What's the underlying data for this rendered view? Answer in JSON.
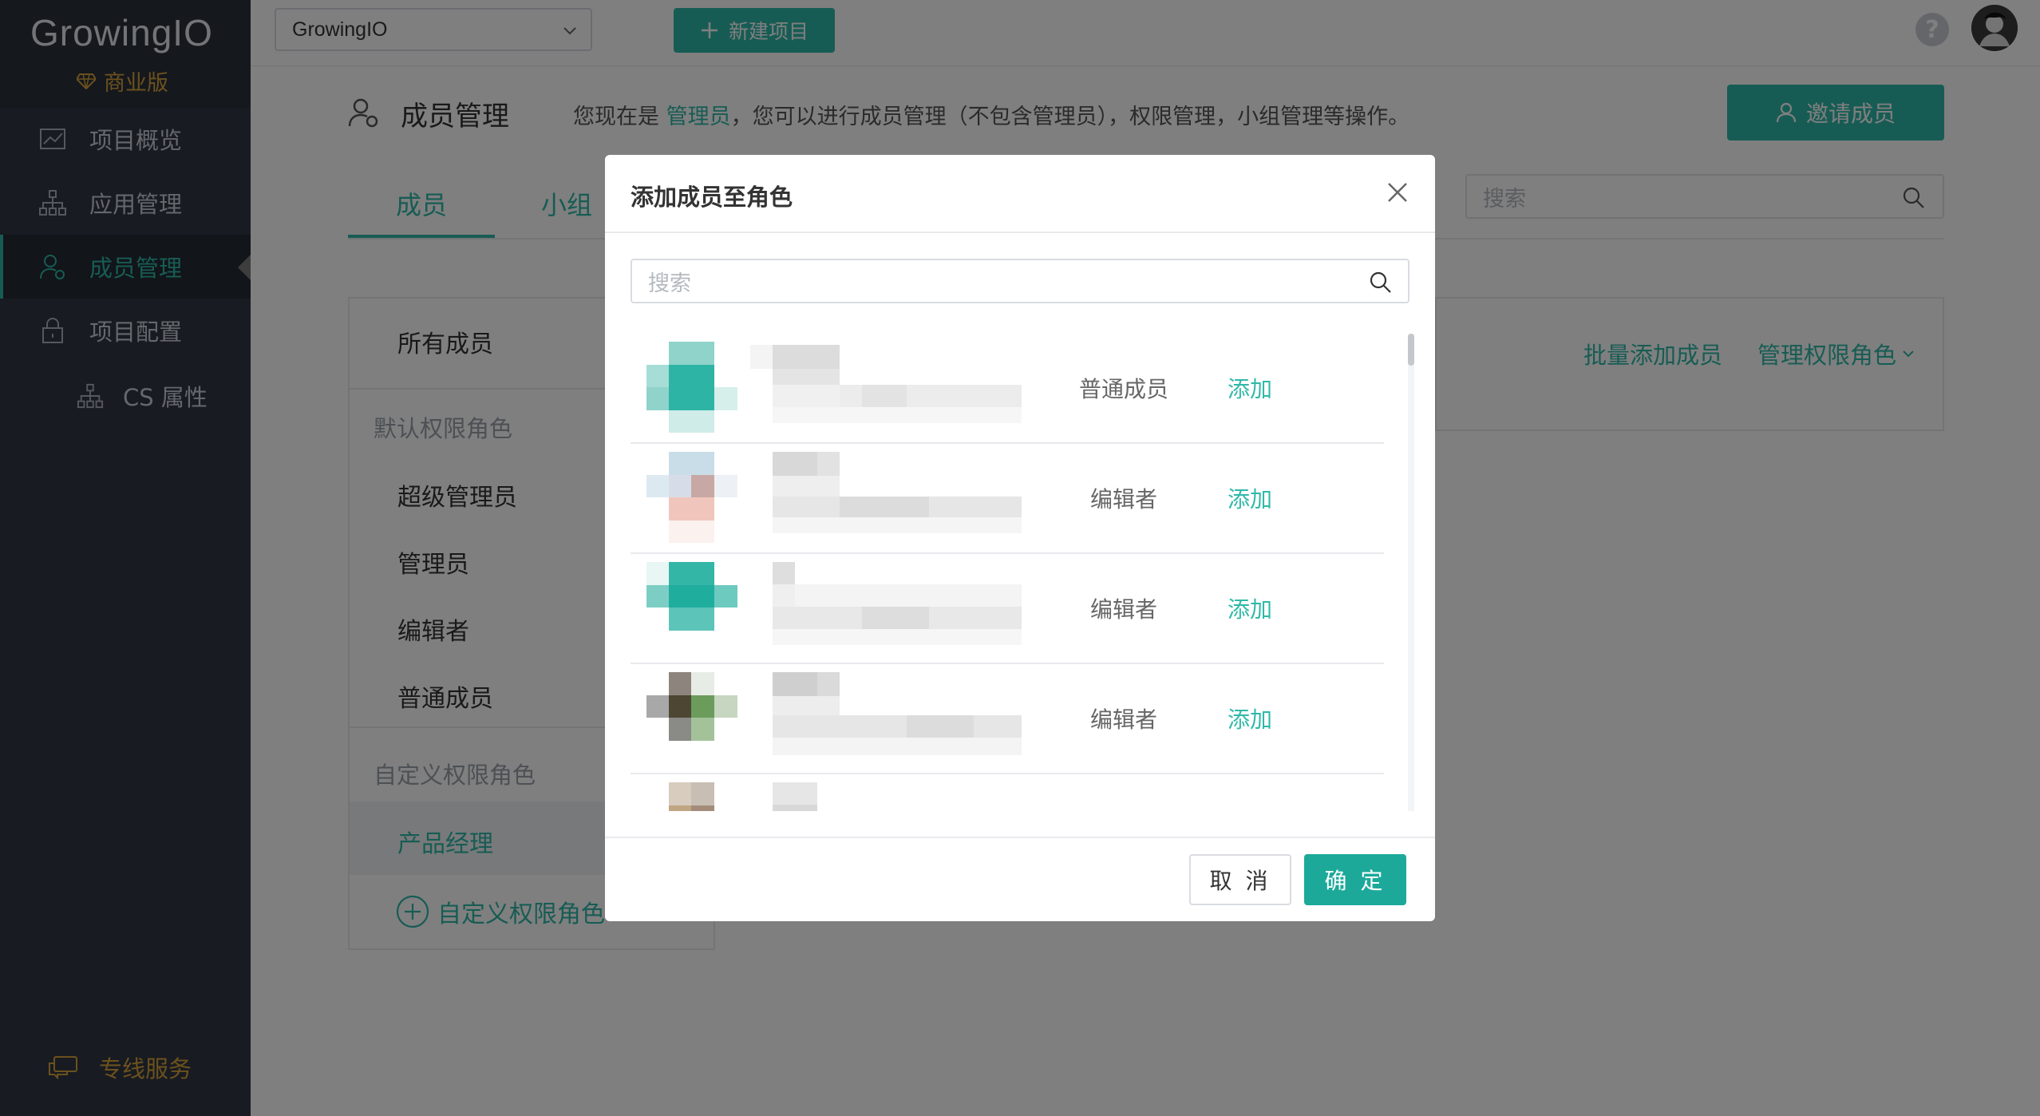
{
  "app": {
    "logo": "GrowingIO",
    "edition": "商业版",
    "service": "专线服务",
    "accent": "#2fb9a8"
  },
  "sidebar": {
    "items": [
      {
        "label": "项目概览",
        "icon": "line-chart-icon"
      },
      {
        "label": "应用管理",
        "icon": "sitemap-icon"
      },
      {
        "label": "成员管理",
        "icon": "user-gear-icon",
        "active": true
      },
      {
        "label": "项目配置",
        "icon": "lock-icon"
      },
      {
        "label": "CS 属性",
        "icon": "sitemap-icon"
      }
    ]
  },
  "header": {
    "project": "GrowingIO",
    "new_project": "新建项目",
    "help": "?"
  },
  "page": {
    "title": "成员管理",
    "desc_prefix": "您现在是",
    "desc_role": "管理员",
    "desc_suffix": "，您可以进行成员管理（不包含管理员），权限管理，小组管理等操作。",
    "invite": "邀请成员",
    "tabs": [
      "成员",
      "小组"
    ],
    "search_placeholder": "搜索",
    "left_panel": {
      "all_members": "所有成员",
      "default_roles_title": "默认权限角色",
      "default_roles": [
        "超级管理员",
        "管理员",
        "编辑者",
        "普通成员"
      ],
      "custom_roles_title": "自定义权限角色",
      "custom_roles": [
        "产品经理"
      ],
      "add_custom": "自定义权限角色"
    },
    "right_links": [
      "批量添加成员",
      "管理权限角色"
    ]
  },
  "modal": {
    "title": "添加成员至角色",
    "search_placeholder": "搜索",
    "rows": [
      {
        "role": "普通成员",
        "action": "添加"
      },
      {
        "role": "编辑者",
        "action": "添加"
      },
      {
        "role": "编辑者",
        "action": "添加"
      },
      {
        "role": "编辑者",
        "action": "添加"
      },
      {
        "role": "",
        "action": ""
      }
    ],
    "cancel": "取 消",
    "ok": "确 定"
  }
}
